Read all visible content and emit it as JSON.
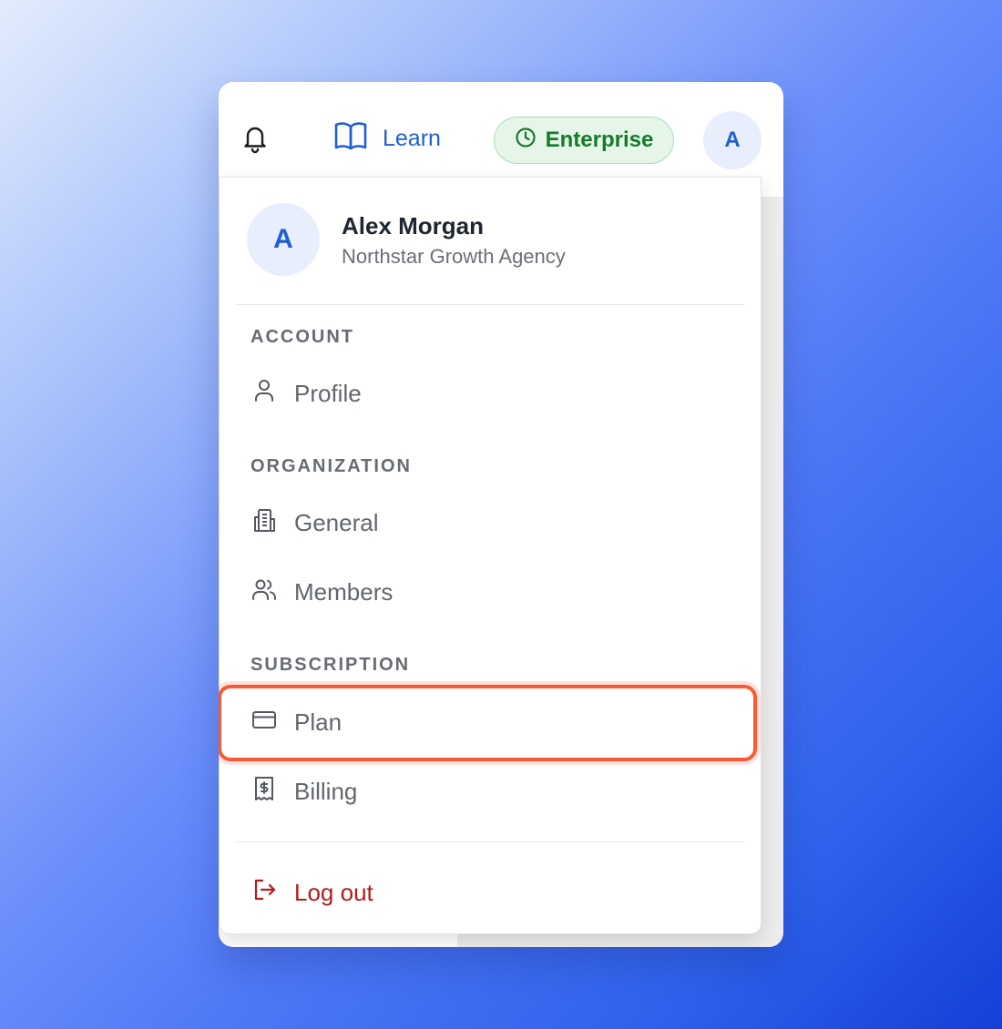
{
  "topbar": {
    "learn_label": "Learn",
    "plan_badge": "Enterprise",
    "avatar_initial": "A"
  },
  "user": {
    "initial": "A",
    "name": "Alex Morgan",
    "organization": "Northstar Growth Agency"
  },
  "menu": {
    "sections": [
      {
        "title": "ACCOUNT",
        "items": [
          {
            "label": "Profile",
            "icon": "user-icon"
          }
        ]
      },
      {
        "title": "ORGANIZATION",
        "items": [
          {
            "label": "General",
            "icon": "building-icon"
          },
          {
            "label": "Members",
            "icon": "users-icon"
          }
        ]
      },
      {
        "title": "SUBSCRIPTION",
        "items": [
          {
            "label": "Plan",
            "icon": "credit-card-icon",
            "highlighted": true
          },
          {
            "label": "Billing",
            "icon": "receipt-dollar-icon"
          }
        ]
      }
    ],
    "logout_label": "Log out"
  },
  "colors": {
    "accent_blue": "#1e5fd3",
    "badge_green": "#177a2a",
    "badge_bg": "#e5f6e9",
    "logout_red": "#b21c1c",
    "highlight": "#fa5a33"
  }
}
